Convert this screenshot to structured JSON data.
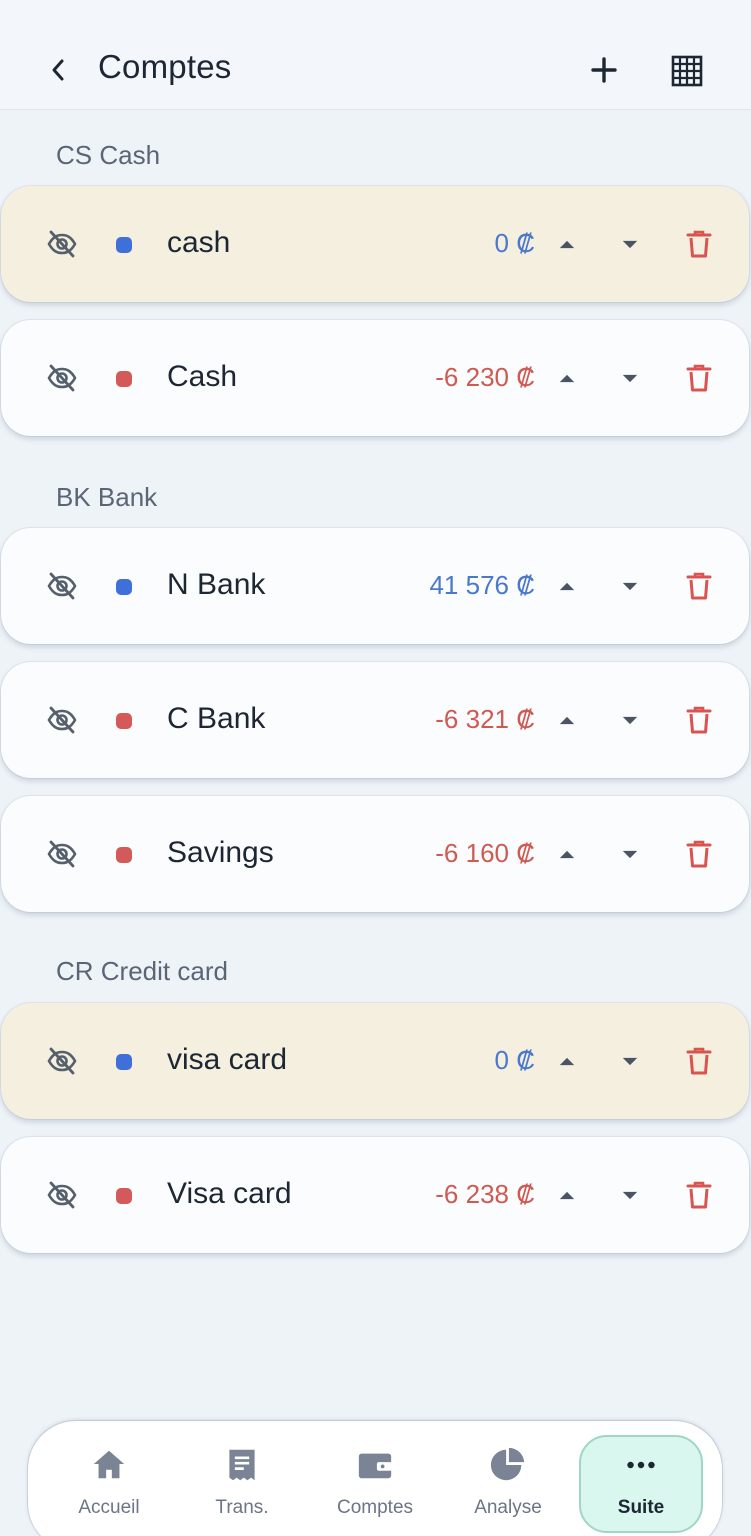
{
  "header": {
    "title": "Comptes"
  },
  "groups": [
    {
      "title": "CS Cash",
      "accounts": [
        {
          "name": "cash",
          "amount": "0 ₡",
          "color": "#3f6fd8",
          "amount_color": "#4a78cc",
          "highlight": true
        },
        {
          "name": "Cash",
          "amount": "-6 230 ₡",
          "color": "#d45a5a",
          "amount_color": "#cf5a52",
          "highlight": false
        }
      ]
    },
    {
      "title": "BK Bank",
      "accounts": [
        {
          "name": "N Bank",
          "amount": "41 576 ₡",
          "color": "#3f6fd8",
          "amount_color": "#4a78cc",
          "highlight": false
        },
        {
          "name": "C Bank",
          "amount": "-6 321 ₡",
          "color": "#d45a5a",
          "amount_color": "#cf5a52",
          "highlight": false
        },
        {
          "name": "Savings",
          "amount": "-6 160 ₡",
          "color": "#d45a5a",
          "amount_color": "#cf5a52",
          "highlight": false
        }
      ]
    },
    {
      "title": "CR Credit card",
      "accounts": [
        {
          "name": "visa card",
          "amount": "0 ₡",
          "color": "#3f6fd8",
          "amount_color": "#4a78cc",
          "highlight": true
        },
        {
          "name": "Visa card",
          "amount": "-6 238 ₡",
          "color": "#d45a5a",
          "amount_color": "#cf5a52",
          "highlight": false
        }
      ]
    }
  ],
  "nav": [
    {
      "label": "Accueil",
      "icon": "home-icon"
    },
    {
      "label": "Trans.",
      "icon": "receipt-icon"
    },
    {
      "label": "Comptes",
      "icon": "wallet-icon"
    },
    {
      "label": "Analyse",
      "icon": "pie-chart-icon"
    },
    {
      "label": "Suite",
      "icon": "more-icon",
      "active": true
    }
  ],
  "colors": {
    "accent": "#d9f7ee",
    "delete": "#d9534f",
    "highlight": "#f4efdf"
  }
}
